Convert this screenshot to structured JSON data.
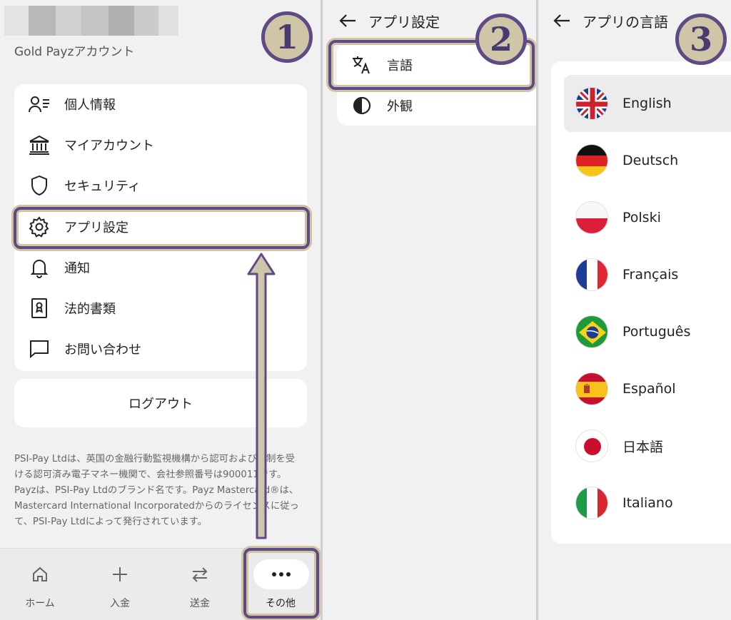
{
  "panel1": {
    "account_label": "Gold Payzアカウント",
    "menu_items": [
      {
        "label": "個人情報",
        "icon": "person-list-icon"
      },
      {
        "label": "マイアカウント",
        "icon": "bank-icon"
      },
      {
        "label": "セキュリティ",
        "icon": "shield-icon"
      },
      {
        "label": "アプリ設定",
        "icon": "gear-icon"
      },
      {
        "label": "通知",
        "icon": "bell-icon"
      },
      {
        "label": "法的書類",
        "icon": "document-badge-icon"
      },
      {
        "label": "お問い合わせ",
        "icon": "chat-bubble-icon"
      }
    ],
    "logout_label": "ログアウト",
    "disclaimer": "PSI-Pay Ltdは、英国の金融行動監視機構から認可および規制を受ける認可済み電子マネー機関で、会社参照番号は900011です。Payzは、PSI-Pay Ltdのブランド名です。Payz Mastercard®は、Mastercard International Incorporatedからのライセンスに従って、PSI-Pay Ltdによって発行されています。",
    "bottom_nav": [
      {
        "label": "ホーム",
        "icon": "home-icon"
      },
      {
        "label": "入金",
        "icon": "plus-icon"
      },
      {
        "label": "送金",
        "icon": "transfer-arrows-icon"
      },
      {
        "label": "その他",
        "icon": "more-dots-icon"
      }
    ],
    "badge": "1"
  },
  "panel2": {
    "title": "アプリ設定",
    "items": [
      {
        "label": "言語",
        "icon": "translate-icon"
      },
      {
        "label": "外観",
        "icon": "contrast-icon"
      }
    ],
    "badge": "2"
  },
  "panel3": {
    "title": "アプリの言語",
    "languages": [
      {
        "label": "English",
        "flag": "uk-flag-icon"
      },
      {
        "label": "Deutsch",
        "flag": "germany-flag-icon"
      },
      {
        "label": "Polski",
        "flag": "poland-flag-icon"
      },
      {
        "label": "Français",
        "flag": "france-flag-icon"
      },
      {
        "label": "Português",
        "flag": "brazil-flag-icon"
      },
      {
        "label": "Español",
        "flag": "spain-flag-icon"
      },
      {
        "label": "日本語",
        "flag": "japan-flag-icon"
      },
      {
        "label": "Italiano",
        "flag": "italy-flag-icon"
      }
    ],
    "badge": "3"
  },
  "colors": {
    "highlight": "#5e4a86",
    "badge_fill": "#cfc6a8",
    "card": "#ffffff",
    "background": "#f1f1f1"
  }
}
